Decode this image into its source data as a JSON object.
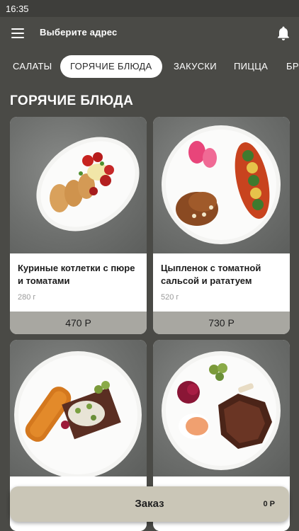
{
  "status_bar": {
    "time": "16:35"
  },
  "header": {
    "title": "Выберите адрес",
    "menu_icon": "menu-icon",
    "bell_icon": "bell-icon"
  },
  "tabs": [
    {
      "label": "САЛАТЫ",
      "active": false
    },
    {
      "label": "ГОРЯЧИЕ БЛЮДА",
      "active": true
    },
    {
      "label": "ЗАКУСКИ",
      "active": false
    },
    {
      "label": "ПИЦЦА",
      "active": false
    },
    {
      "label": "БРУ",
      "active": false
    }
  ],
  "section": {
    "title": "ГОРЯЧИЕ БЛЮДА"
  },
  "products": [
    {
      "name": "Куриные котлетки с пюре и томатами",
      "weight": "280 г",
      "price": "470 Р"
    },
    {
      "name": "Цыпленок с томатной сальсой и рататуем",
      "weight": "520 г",
      "price": "730 Р"
    },
    {
      "name": "",
      "weight": "",
      "price": ""
    },
    {
      "name": "",
      "weight": "",
      "price": ""
    }
  ],
  "order": {
    "label": "Заказ",
    "total": "0 Р"
  },
  "colors": {
    "background": "#4a4a46",
    "price_bar": "#a8a7a1",
    "order_bar": "#cac6b7",
    "tab_active_bg": "#ffffff"
  }
}
